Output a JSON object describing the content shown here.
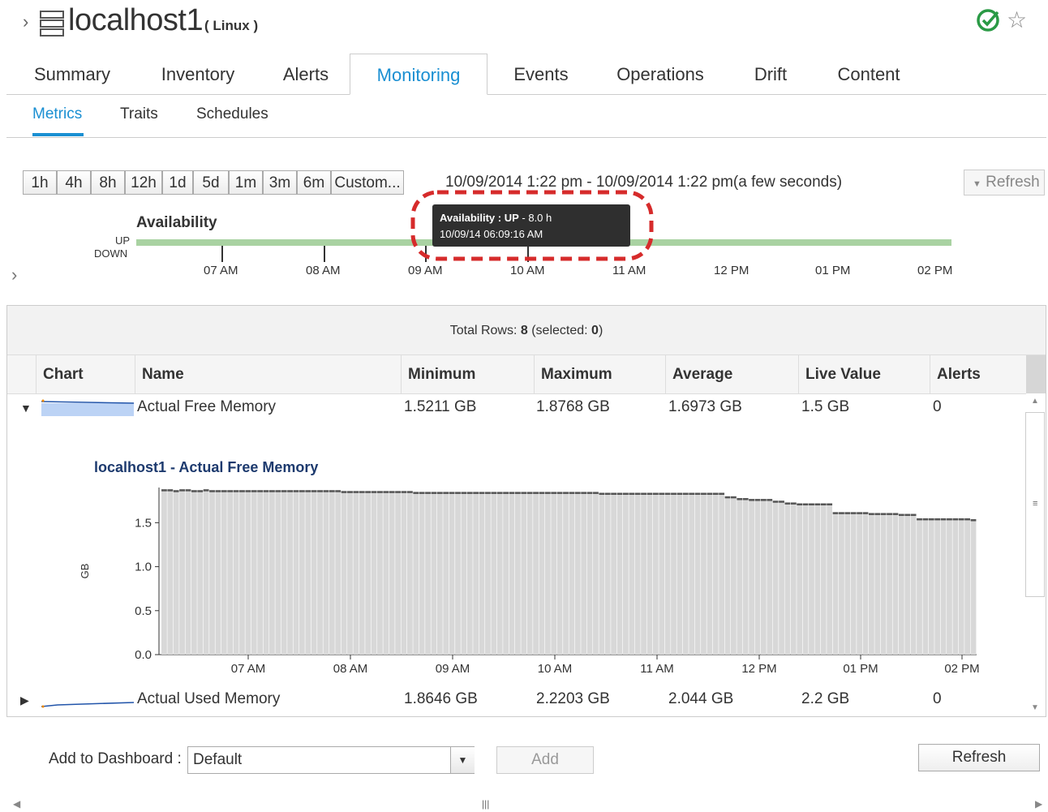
{
  "header": {
    "title": "localhost1",
    "os": "( Linux )",
    "icons": {
      "expand": "chevron-right-icon",
      "server": "server-icon",
      "status": "check-circle-icon",
      "favorite": "star-icon"
    }
  },
  "tabs": [
    "Summary",
    "Inventory",
    "Alerts",
    "Monitoring",
    "Events",
    "Operations",
    "Drift",
    "Content"
  ],
  "active_tab": "Monitoring",
  "subtabs": [
    "Metrics",
    "Traits",
    "Schedules"
  ],
  "active_subtab": "Metrics",
  "range_buttons": [
    "1h",
    "4h",
    "8h",
    "12h",
    "1d",
    "5d",
    "1m",
    "3m",
    "6m",
    "Custom..."
  ],
  "range_text": "10/09/2014 1:22 pm - 10/09/2014 1:22 pm(a few seconds)",
  "refresh_top": "Refresh",
  "availability": {
    "label": "Availability",
    "up": "UP",
    "down": "DOWN",
    "time_labels": [
      "07 AM",
      "08 AM",
      "09 AM",
      "10 AM",
      "11 AM",
      "12 PM",
      "01 PM",
      "02 PM"
    ],
    "tooltip": {
      "title": "Availability : UP",
      "duration": " - 8.0 h",
      "timestamp": "10/09/14 06:09:16 AM"
    }
  },
  "grid": {
    "total_rows_prefix": "Total Rows: ",
    "total_rows": "8",
    "selected_prefix": " (selected: ",
    "selected": "0",
    "selected_suffix": ")",
    "columns": [
      "Chart",
      "Name",
      "Minimum",
      "Maximum",
      "Average",
      "Live Value",
      "Alerts"
    ],
    "rows": [
      {
        "name": "Actual Free Memory",
        "minimum": "1.5211 GB",
        "maximum": "1.8768 GB",
        "average": "1.6973 GB",
        "live": "1.5 GB",
        "alerts": "0"
      },
      {
        "name": "Actual Used Memory",
        "minimum": "1.8646 GB",
        "maximum": "2.2203 GB",
        "average": "2.044 GB",
        "live": "2.2 GB",
        "alerts": "0"
      }
    ]
  },
  "chart_data": {
    "type": "bar",
    "title": "localhost1 - Actual Free Memory",
    "xlabel": "",
    "ylabel": "GB",
    "ylim": [
      0,
      1.9
    ],
    "yticks": [
      0.0,
      0.5,
      1.0,
      1.5
    ],
    "ytick_labels": [
      "0.0",
      "0.5",
      "1.0",
      "1.5"
    ],
    "xtick_labels": [
      "07 AM",
      "08 AM",
      "09 AM",
      "10 AM",
      "11 AM",
      "12 PM",
      "01 PM",
      "02 PM"
    ],
    "bar_color": "#d8d8d8",
    "values": [
      1.88,
      1.88,
      1.87,
      1.88,
      1.88,
      1.87,
      1.87,
      1.88,
      1.87,
      1.87,
      1.87,
      1.87,
      1.87,
      1.87,
      1.87,
      1.87,
      1.87,
      1.87,
      1.87,
      1.87,
      1.87,
      1.87,
      1.87,
      1.87,
      1.87,
      1.87,
      1.87,
      1.87,
      1.87,
      1.87,
      1.86,
      1.86,
      1.86,
      1.86,
      1.86,
      1.86,
      1.86,
      1.86,
      1.86,
      1.86,
      1.86,
      1.86,
      1.85,
      1.85,
      1.85,
      1.85,
      1.85,
      1.85,
      1.85,
      1.85,
      1.85,
      1.85,
      1.85,
      1.85,
      1.85,
      1.85,
      1.85,
      1.85,
      1.85,
      1.85,
      1.85,
      1.85,
      1.85,
      1.85,
      1.85,
      1.85,
      1.85,
      1.85,
      1.85,
      1.85,
      1.85,
      1.85,
      1.85,
      1.84,
      1.84,
      1.84,
      1.84,
      1.84,
      1.84,
      1.84,
      1.84,
      1.84,
      1.84,
      1.84,
      1.84,
      1.84,
      1.84,
      1.84,
      1.84,
      1.84,
      1.84,
      1.84,
      1.84,
      1.84,
      1.8,
      1.8,
      1.78,
      1.78,
      1.77,
      1.77,
      1.77,
      1.77,
      1.75,
      1.75,
      1.73,
      1.73,
      1.72,
      1.72,
      1.72,
      1.72,
      1.72,
      1.72,
      1.62,
      1.62,
      1.62,
      1.62,
      1.62,
      1.62,
      1.61,
      1.61,
      1.61,
      1.61,
      1.61,
      1.6,
      1.6,
      1.6,
      1.55,
      1.55,
      1.55,
      1.55,
      1.55,
      1.55,
      1.55,
      1.55,
      1.55,
      1.54
    ]
  },
  "dashboard": {
    "label": "Add to Dashboard :",
    "selected": "Default",
    "add_label": "Add",
    "refresh_label": "Refresh"
  },
  "colors": {
    "accent": "#1a8fd2",
    "availability_up": "#a9d2a2",
    "title_navy": "#1d3a6e",
    "tooltip_bg": "#2f2f2f",
    "annotation_red": "#d62b2b"
  }
}
